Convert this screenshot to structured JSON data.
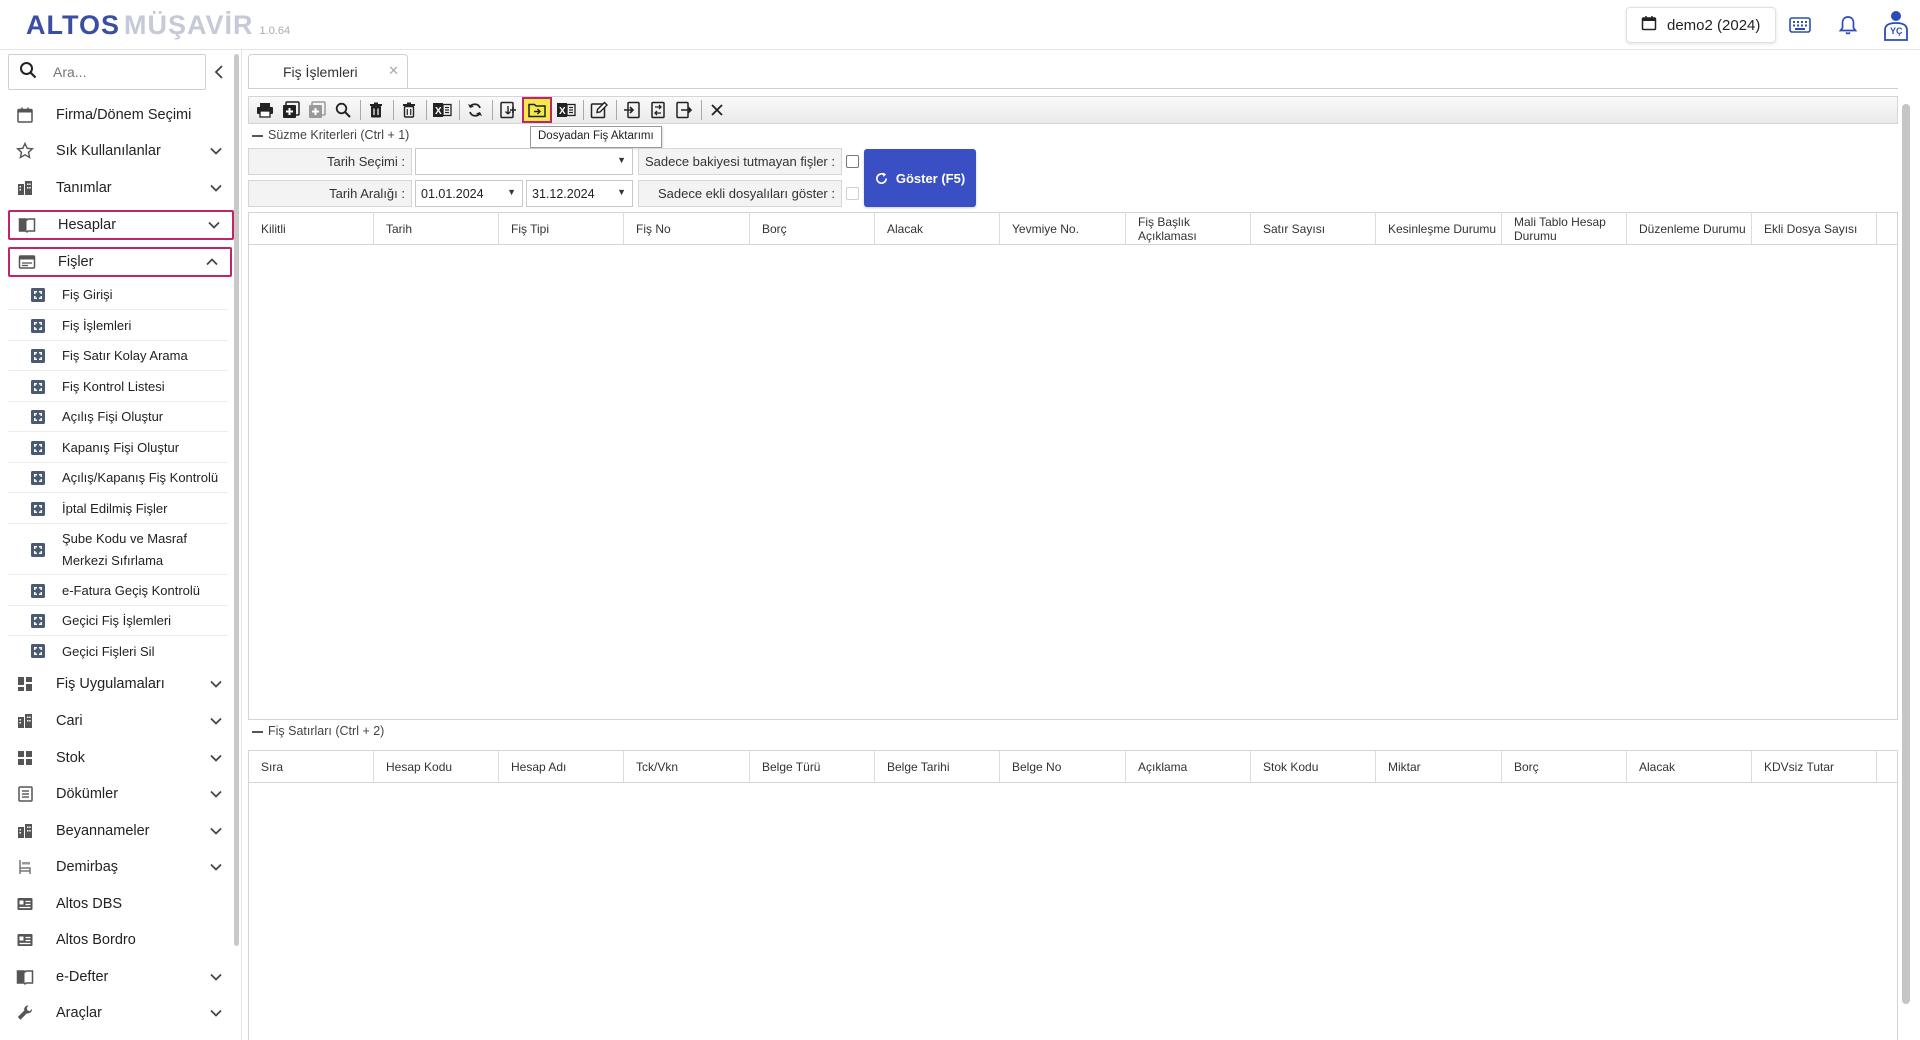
{
  "app": {
    "logo_main": "ALTOS",
    "logo_sub": "MÜŞAVİR",
    "version": "1.0.64",
    "company": "demo2 (2024)",
    "avatar_initials": "YÇ"
  },
  "sidebar": {
    "search_placeholder": "Ara...",
    "items": [
      {
        "label": "Firma/Dönem Seçimi",
        "icon": "calendar-icon"
      },
      {
        "label": "Sık Kullanılanlar",
        "icon": "star-icon"
      },
      {
        "label": "Tanımlar",
        "icon": "building-icon"
      },
      {
        "label": "Hesaplar",
        "icon": "book-icon"
      },
      {
        "label": "Fişler",
        "icon": "receipt-icon"
      }
    ],
    "sub_items": [
      "Fiş Girişi",
      "Fiş İşlemleri",
      "Fiş Satır Kolay Arama",
      "Fiş Kontrol Listesi",
      "Açılış Fişi Oluştur",
      "Kapanış Fişi Oluştur",
      "Açılış/Kapanış Fiş Kontrolü",
      "İptal Edilmiş Fişler",
      "Şube Kodu ve Masraf",
      "Merkezi Sıfırlama",
      "e-Fatura Geçiş Kontrolü",
      "Geçici Fiş İşlemleri",
      "Geçici Fişleri Sil"
    ],
    "items2": [
      {
        "label": "Fiş Uygulamaları",
        "icon": "grid-icon"
      },
      {
        "label": "Cari",
        "icon": "building-icon"
      },
      {
        "label": "Stok",
        "icon": "boxes-icon"
      },
      {
        "label": "Dökümler",
        "icon": "list-icon"
      },
      {
        "label": "Beyannameler",
        "icon": "building-icon"
      },
      {
        "label": "Demirbaş",
        "icon": "chair-icon"
      },
      {
        "label": "Altos DBS",
        "icon": "id-card-icon"
      },
      {
        "label": "Altos Bordro",
        "icon": "id-card-icon"
      },
      {
        "label": "e-Defter",
        "icon": "book-icon"
      },
      {
        "label": "Araçlar",
        "icon": "wrench-icon"
      }
    ]
  },
  "tab": {
    "label": "Fiş İşlemleri"
  },
  "toolbar": {
    "tooltip": "Dosyadan Fiş Aktarımı"
  },
  "filter": {
    "section_label": "Süzme Kriterleri (Ctrl + 1)",
    "date_selection_label": "Tarih Seçimi :",
    "date_selection_value": "",
    "date_range_label": "Tarih Aralığı :",
    "date_from": "01.01.2024",
    "date_to": "31.12.2024",
    "unbalanced_label": "Sadece bakiyesi tutmayan fişler :",
    "attached_label": "Sadece ekli dosyalıları göster :",
    "show_button": "Göster (F5)"
  },
  "vouchers_grid": {
    "columns": [
      "Kilitli",
      "Tarih",
      "Fiş Tipi",
      "Fiş No",
      "Borç",
      "Alacak",
      "Yevmiye No.",
      "Fiş Başlık Açıklaması",
      "Satır Sayısı",
      "Kesinleşme Durumu",
      "Mali Tablo Hesap Durumu",
      "Düzenleme Durumu",
      "Ekli Dosya Sayısı"
    ]
  },
  "lines": {
    "section_label": "Fiş Satırları (Ctrl + 2)",
    "columns": [
      "Sıra",
      "Hesap Kodu",
      "Hesap Adı",
      "Tck/Vkn",
      "Belge Türü",
      "Belge Tarihi",
      "Belge No",
      "Açıklama",
      "Stok Kodu",
      "Miktar",
      "Borç",
      "Alacak",
      "KDVsiz Tutar"
    ]
  }
}
